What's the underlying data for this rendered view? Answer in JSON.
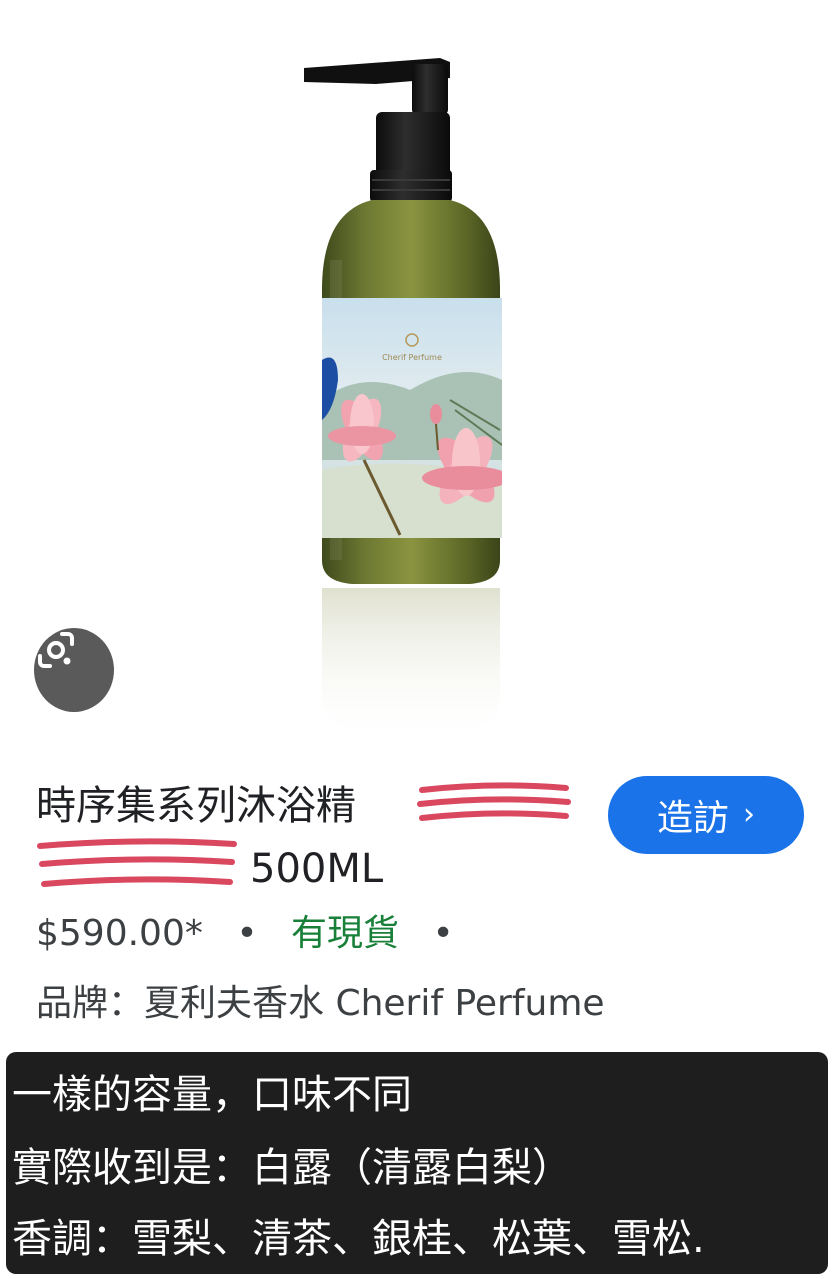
{
  "product": {
    "title_line1": "時序集系列沐浴精",
    "title_line2": "500ML",
    "price": "$590.00*",
    "separator": "•",
    "stock_status": "有現貨",
    "brand": "品牌：夏利夫香水 Cherif Perfume",
    "label_logo_text": "Cherif Perfume"
  },
  "actions": {
    "visit_label": "造訪",
    "visit_chevron": "›",
    "lens_icon": "google-lens-icon"
  },
  "caption": {
    "line1": "一樣的容量，口味不同",
    "line2": "實際收到是：白露（清露白梨）",
    "line3": "香調：雪梨、清茶、銀桂、松葉、雪松."
  },
  "colors": {
    "visit_button": "#1a73e8",
    "stock_green": "#188038",
    "redaction_red": "#d9485f",
    "caption_bg": "#1e1e1e"
  }
}
